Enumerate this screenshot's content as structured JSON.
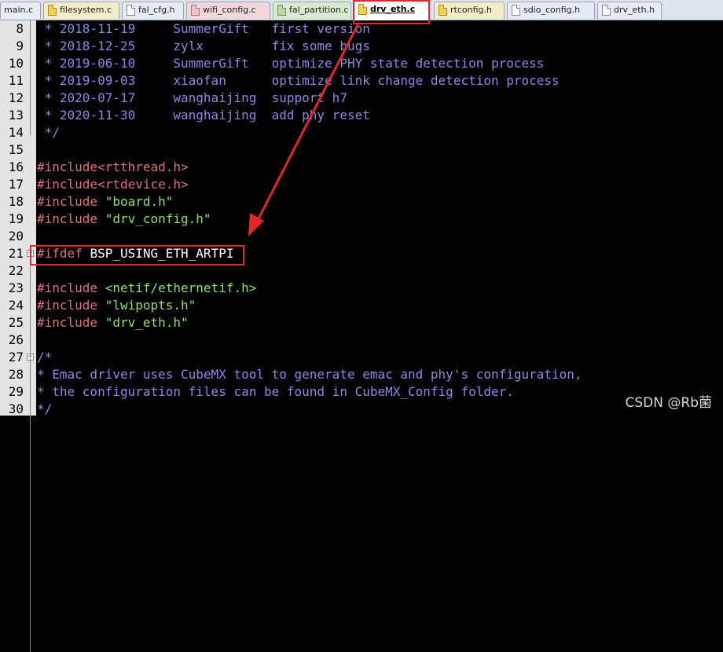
{
  "tabs": [
    {
      "label": "main.c",
      "kind": "plain"
    },
    {
      "label": "filesystem.c",
      "kind": "c"
    },
    {
      "label": "fal_cfg.h",
      "kind": "h"
    },
    {
      "label": "wifi_config.c",
      "kind": "pink"
    },
    {
      "label": "fal_partition.c",
      "kind": "green"
    },
    {
      "label": "drv_eth.c",
      "kind": "active"
    },
    {
      "label": "rtconfig.h",
      "kind": "c"
    },
    {
      "label": "sdio_config.h",
      "kind": "h"
    },
    {
      "label": "drv_eth.h",
      "kind": "h"
    }
  ],
  "active_tab": "drv_eth.c",
  "code_lines": [
    {
      "no": "8",
      "parts": [
        {
          "c": "cm",
          "t": " * 2018-11-19     SummerGift   first version"
        }
      ]
    },
    {
      "no": "9",
      "parts": [
        {
          "c": "cm",
          "t": " * 2018-12-25     zylx         fix some bugs"
        }
      ]
    },
    {
      "no": "10",
      "parts": [
        {
          "c": "cm",
          "t": " * 2019-06-10     SummerGift   optimize PHY state detection process"
        }
      ]
    },
    {
      "no": "11",
      "parts": [
        {
          "c": "cm",
          "t": " * 2019-09-03     xiaofan      optimize link change detection process"
        }
      ]
    },
    {
      "no": "12",
      "parts": [
        {
          "c": "cm",
          "t": " * 2020-07-17     wanghaijing  support h7"
        }
      ]
    },
    {
      "no": "13",
      "parts": [
        {
          "c": "cm",
          "t": " * 2020-11-30     wanghaijing  add phy reset"
        }
      ]
    },
    {
      "no": "14",
      "parts": [
        {
          "c": "cm",
          "t": " */"
        }
      ]
    },
    {
      "no": "15",
      "parts": []
    },
    {
      "no": "16",
      "parts": [
        {
          "c": "pp",
          "t": "#include<rtthread.h>"
        }
      ]
    },
    {
      "no": "17",
      "parts": [
        {
          "c": "pp",
          "t": "#include<rtdevice.h>"
        }
      ]
    },
    {
      "no": "18",
      "parts": [
        {
          "c": "pp",
          "t": "#include "
        },
        {
          "c": "str",
          "t": "\"board.h\""
        }
      ]
    },
    {
      "no": "19",
      "parts": [
        {
          "c": "pp",
          "t": "#include "
        },
        {
          "c": "str",
          "t": "\"drv_config.h\""
        }
      ]
    },
    {
      "no": "20",
      "parts": []
    },
    {
      "no": "21",
      "parts": [
        {
          "c": "pp",
          "t": "#ifdef "
        },
        {
          "c": "id",
          "t": "BSP_USING_ETH_ARTPI"
        }
      ]
    },
    {
      "no": "22",
      "parts": []
    },
    {
      "no": "23",
      "parts": [
        {
          "c": "pp",
          "t": "#include "
        },
        {
          "c": "str",
          "t": "<netif/ethernetif.h>"
        }
      ]
    },
    {
      "no": "24",
      "parts": [
        {
          "c": "pp",
          "t": "#include "
        },
        {
          "c": "str",
          "t": "\"lwipopts.h\""
        }
      ]
    },
    {
      "no": "25",
      "parts": [
        {
          "c": "pp",
          "t": "#include "
        },
        {
          "c": "str",
          "t": "\"drv_eth.h\""
        }
      ]
    },
    {
      "no": "26",
      "parts": []
    },
    {
      "no": "27",
      "parts": [
        {
          "c": "cm",
          "t": "/*"
        }
      ]
    },
    {
      "no": "28",
      "parts": [
        {
          "c": "cm",
          "t": "* Emac driver uses CubeMX tool to generate emac and phy's configuration,"
        }
      ]
    },
    {
      "no": "29",
      "parts": [
        {
          "c": "cm",
          "t": "* the configuration files can be found in CubeMX_Config folder."
        }
      ]
    },
    {
      "no": "30",
      "parts": [
        {
          "c": "cm",
          "t": "*/"
        }
      ]
    }
  ],
  "annotation": {
    "color": "#e2262a"
  },
  "watermark": "CSDN @Rb菌",
  "icons": {
    "file": "file-icon",
    "fold_minus": "fold-minus-icon"
  }
}
